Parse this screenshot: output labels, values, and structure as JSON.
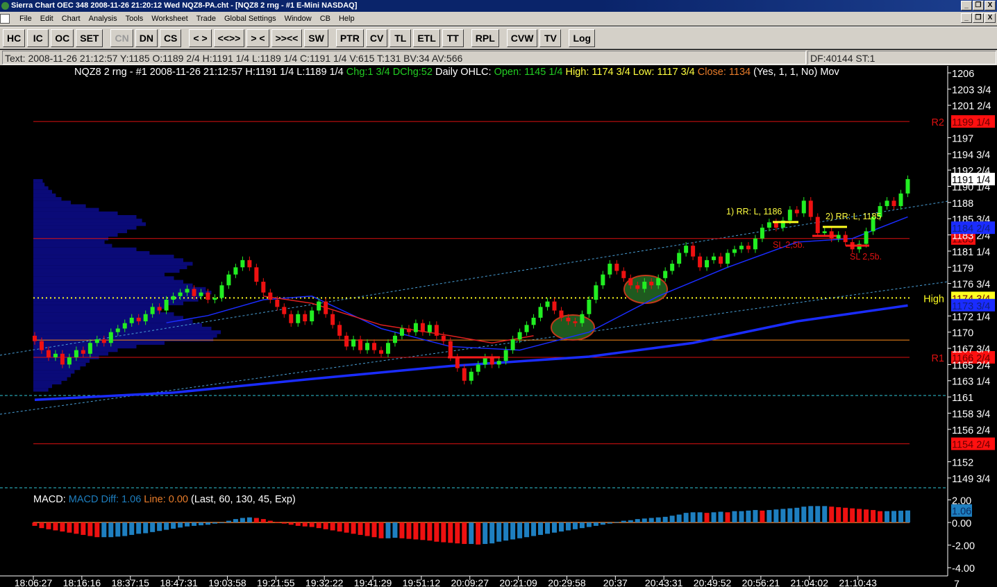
{
  "window": {
    "title": "Sierra Chart OEC 348  2008-11-26  21:20:12  Wed   NQZ8-PA.cht - [NQZ8  2 rng - #1 E-Mini NASDAQ]",
    "controls": [
      "_",
      "❐",
      "X"
    ]
  },
  "menu": [
    "File",
    "Edit",
    "Chart",
    "Analysis",
    "Tools",
    "Worksheet",
    "Trade",
    "Global Settings",
    "Window",
    "CB",
    "Help"
  ],
  "toolbar": {
    "groups": [
      [
        "HC",
        "IC",
        "OC",
        "SET"
      ],
      [
        "CN",
        "DN",
        "CS"
      ],
      [
        "< >",
        "<<>>",
        "> <",
        ">><<",
        "SW"
      ],
      [
        "PTR",
        "CV",
        "TL",
        "ETL",
        "TT"
      ],
      [
        "RPL"
      ],
      [
        "CVW",
        "TV"
      ],
      [
        "Log"
      ]
    ],
    "disabled": [
      "CN"
    ]
  },
  "infobar": {
    "text": "Text: 2008-11-26  21:12:57  Y:1185  O:1189 2/4  H:1191 1/4  L:1189 1/4  C:1191 1/4  V:615  T:131  BV:34  AV:566",
    "right": "DF:40144  ST:1"
  },
  "legend": {
    "symbol": "NQZ8  2 rng - #1  2008-11-26  21:12:57  H:1191 1/4  L:1189 1/4",
    "chg": "Chg:1 3/4",
    "dchg": "DChg:52",
    "daily": "Daily OHLC:",
    "open": "Open: 1145 1/4",
    "high": "High: 1174 3/4",
    "low": "Low: 1117 3/4",
    "close": "Close: 1134",
    "params": "(Yes, 1, 1, No)",
    "more": "Mov"
  },
  "macd_legend": {
    "name": "MACD:",
    "diff": "MACD Diff: 1.06",
    "line": "Line: 0.00",
    "params": "(Last, 60, 130, 45, Exp)"
  },
  "colors": {
    "up": "#22ee22",
    "down": "#ee1111",
    "profile": "#0a0a78",
    "ma_slow": "#1a2cff",
    "ma_fast": "#e02020",
    "macd_up": "#1e7fc0",
    "macd_down": "#ee1111"
  },
  "chart_data": {
    "type": "candlestick",
    "title": "NQZ8 2 rng - #1",
    "ylim": [
      1148.5,
      1206
    ],
    "price_ticks": [
      "1206",
      "1203 3/4",
      "1201 2/4",
      "1197",
      "1194 3/4",
      "1192 2/4",
      "1190 1/4",
      "1188",
      "1185 3/4",
      "1183 2/4",
      "1181 1/4",
      "1179",
      "1176 3/4",
      "1172 1/4",
      "1170",
      "1167 3/4",
      "1165 2/4",
      "1163 1/4",
      "1161",
      "1158 3/4",
      "1156 2/4",
      "1152",
      "1149 3/4"
    ],
    "price_tick_values": [
      1206,
      1203.75,
      1201.5,
      1197,
      1194.75,
      1192.5,
      1190.25,
      1188,
      1185.75,
      1183.5,
      1181.25,
      1179,
      1176.75,
      1172.25,
      1170,
      1167.75,
      1165.5,
      1163.25,
      1161,
      1158.75,
      1156.5,
      1152,
      1149.75
    ],
    "first_open": 1169.5,
    "closes": [
      1168.75,
      1167.5,
      1166.5,
      1167,
      1165.5,
      1166.5,
      1167.5,
      1167,
      1168.5,
      1169,
      1168.5,
      1170,
      1170.5,
      1171.25,
      1172,
      1171.5,
      1172.5,
      1173.5,
      1173,
      1174.5,
      1175,
      1175.5,
      1176,
      1175,
      1175.5,
      1174.5,
      1174.75,
      1176.5,
      1178,
      1179,
      1180,
      1179,
      1177,
      1175.5,
      1174.5,
      1173.5,
      1172.5,
      1171.25,
      1172.5,
      1171.5,
      1173,
      1174.25,
      1172.5,
      1171,
      1169.5,
      1168,
      1169,
      1167.5,
      1168.5,
      1167.5,
      1167,
      1168.5,
      1169.5,
      1170.5,
      1170,
      1171.25,
      1170,
      1171,
      1169.5,
      1168.75,
      1166.5,
      1165,
      1163.25,
      1164.5,
      1165.5,
      1166.5,
      1165.5,
      1166,
      1167.5,
      1169,
      1170,
      1171,
      1172,
      1173.5,
      1174.25,
      1173,
      1172,
      1171.5,
      1171.25,
      1172.5,
      1174.5,
      1176.5,
      1178,
      1179.5,
      1178.5,
      1177.5,
      1176.5,
      1176,
      1177,
      1176.5,
      1177.5,
      1178.5,
      1179.5,
      1181,
      1182,
      1180.5,
      1179,
      1180,
      1180.5,
      1179.5,
      1181,
      1181.5,
      1182,
      1181.5,
      1183,
      1184.5,
      1185.25,
      1184.5,
      1185.5,
      1187,
      1186.5,
      1188.25,
      1186,
      1183.75,
      1184,
      1183,
      1183.5,
      1182.5,
      1181.5,
      1182.25,
      1184,
      1186,
      1187.5,
      1188.25,
      1187.5,
      1189.25,
      1191.25
    ],
    "ma_slow": [
      [
        0,
        1160.6
      ],
      [
        20,
        1161.6
      ],
      [
        40,
        1163.5
      ],
      [
        60,
        1165.3
      ],
      [
        80,
        1166.6
      ],
      [
        95,
        1168.5
      ],
      [
        110,
        1171.5
      ],
      [
        126,
        1173.7
      ]
    ],
    "ma_mid": [
      [
        19,
        1171.3
      ],
      [
        25,
        1172.3
      ],
      [
        33,
        1174.5
      ],
      [
        40,
        1175
      ],
      [
        50,
        1170.5
      ],
      [
        60,
        1168
      ],
      [
        70,
        1167.5
      ],
      [
        80,
        1170
      ],
      [
        90,
        1175
      ],
      [
        100,
        1179
      ],
      [
        110,
        1182.5
      ],
      [
        118,
        1183
      ],
      [
        126,
        1186
      ]
    ],
    "ma_fast": [
      [
        33,
        1175
      ],
      [
        40,
        1174
      ],
      [
        50,
        1171
      ],
      [
        60,
        1169.5
      ],
      [
        66,
        1168.5
      ],
      [
        72,
        1169.5
      ]
    ],
    "levels": [
      {
        "label": "R2",
        "value": 1199.25,
        "tag": "1199 1/4",
        "color": "#dd1111"
      },
      {
        "label": "",
        "value": 1183,
        "tag": "1183",
        "color": "#dd1111"
      },
      {
        "label": "High",
        "value": 1174.75,
        "tag": "1174 3/4",
        "color": "#ffff20",
        "dotted": true
      },
      {
        "label": "",
        "value": 1168.9,
        "tag": "",
        "color": "#ff8c1a"
      },
      {
        "label": "R1",
        "value": 1166.5,
        "tag": "1166 2/4",
        "color": "#dd1111"
      },
      {
        "label": "",
        "value": 1154.5,
        "tag": "1154 2/4",
        "color": "#dd1111"
      }
    ],
    "price_tags": [
      {
        "text": "1191 1/4",
        "value": 1191.25,
        "bg": "#ffffff"
      },
      {
        "text": "1184 2/4",
        "value": 1184.5,
        "bg": "#1a2cff"
      },
      {
        "text": "1173 3/4",
        "value": 1173.75,
        "bg": "#1a2cff"
      }
    ],
    "profile_top": 1191,
    "profile_step": 0.5,
    "profile_volume": [
      5,
      6,
      8,
      10,
      12,
      15,
      20,
      28,
      35,
      45,
      55,
      58,
      60,
      55,
      50,
      45,
      40,
      38,
      42,
      55,
      62,
      75,
      80,
      85,
      82,
      78,
      70,
      75,
      80,
      85,
      92,
      95,
      90,
      88,
      80,
      72,
      68,
      75,
      80,
      85,
      90,
      95,
      100,
      98,
      96,
      70,
      55,
      45,
      40,
      35,
      30,
      28,
      25,
      22,
      20,
      18,
      15,
      10,
      8
    ],
    "annotations": [
      {
        "text": "1) RR: L, 1186"
      },
      {
        "text": "2) RR: L, 1185"
      },
      {
        "text": "SL 2,5b."
      },
      {
        "text": "SL 2,5b."
      }
    ],
    "macd": {
      "ylim": [
        -4.5,
        2.5
      ],
      "ticks": [
        "2.00",
        "0.00",
        "-2.00",
        "-4.00"
      ],
      "tick_values": [
        2,
        0,
        -2,
        -4
      ],
      "last": "1.06",
      "last_value": 1.06,
      "diff": [
        -0.3,
        -0.5,
        -0.6,
        -0.7,
        -0.8,
        -0.9,
        -1.0,
        -1.1,
        -1.2,
        -1.3,
        -1.3,
        -1.3,
        -1.25,
        -1.2,
        -1.1,
        -1.0,
        -0.95,
        -0.85,
        -0.75,
        -0.65,
        -0.55,
        -0.45,
        -0.35,
        -0.3,
        -0.25,
        -0.2,
        -0.1,
        0.0,
        0.15,
        0.3,
        0.4,
        0.45,
        0.4,
        0.3,
        0.15,
        0.05,
        -0.1,
        -0.2,
        -0.3,
        -0.35,
        -0.4,
        -0.5,
        -0.6,
        -0.7,
        -0.8,
        -0.9,
        -1.0,
        -1.1,
        -1.2,
        -1.3,
        -1.4,
        -1.4,
        -1.35,
        -1.4,
        -1.45,
        -1.5,
        -1.55,
        -1.6,
        -1.7,
        -1.75,
        -1.8,
        -1.85,
        -1.9,
        -1.9,
        -1.95,
        -1.9,
        -1.85,
        -1.7,
        -1.6,
        -1.5,
        -1.4,
        -1.3,
        -1.2,
        -1.1,
        -1.0,
        -0.9,
        -0.8,
        -0.7,
        -0.6,
        -0.5,
        -0.4,
        -0.3,
        -0.2,
        -0.1,
        0.05,
        0.15,
        0.2,
        0.3,
        0.35,
        0.4,
        0.45,
        0.5,
        0.6,
        0.7,
        0.85,
        0.9,
        0.9,
        0.85,
        0.9,
        0.95,
        0.9,
        1.0,
        1.0,
        1.05,
        1.1,
        1.05,
        1.1,
        1.15,
        1.2,
        1.25,
        1.3,
        1.4,
        1.45,
        1.45,
        1.45,
        1.4,
        1.35,
        1.3,
        1.25,
        1.2,
        1.15,
        1.1,
        1.0,
        1.0,
        1.02,
        1.04,
        1.06
      ]
    },
    "time_labels": [
      "18:06:27",
      "18:16:16",
      "18:37:15",
      "18:47:31",
      "19:03:58",
      "19:21:55",
      "19:32:22",
      "19:41:29",
      "19:51:12",
      "20:09:27",
      "20:21:09",
      "20:29:58",
      "20:37",
      "20:43:31",
      "20:49:52",
      "20:56:21",
      "21:04:02",
      "21:10:43"
    ],
    "time_label_every": 7,
    "corner": "7"
  }
}
